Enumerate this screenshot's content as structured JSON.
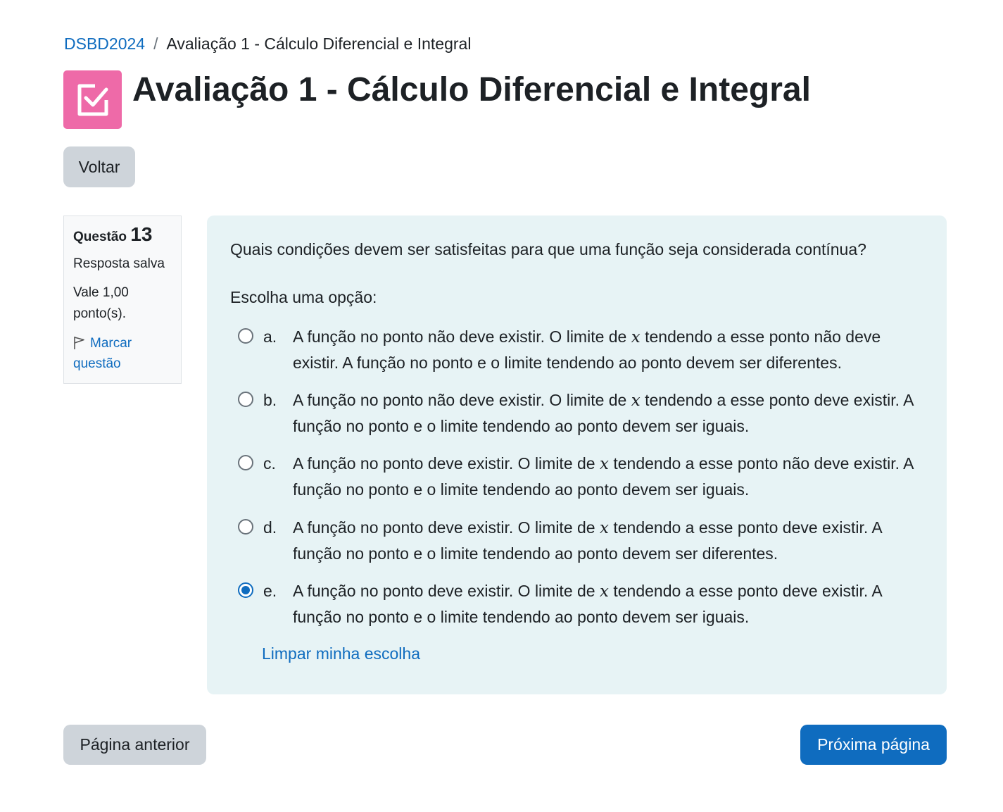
{
  "breadcrumb": {
    "course": "DSBD2024",
    "separator": "/",
    "current": "Avaliação 1 - Cálculo Diferencial e Integral"
  },
  "page": {
    "title": "Avaliação 1 - Cálculo Diferencial e Integral",
    "icon": "quiz-checkbox-icon",
    "icon_color": "#ee6aa8"
  },
  "buttons": {
    "back": "Voltar",
    "prev": "Página anterior",
    "next": "Próxima página"
  },
  "question_info": {
    "label": "Questão",
    "number": "13",
    "state": "Resposta salva",
    "grade": "Vale 1,00 ponto(s).",
    "flag": "Marcar questão"
  },
  "question": {
    "text": "Quais condições devem ser satisfeitas para que uma função seja considerada contínua?",
    "prompt": "Escolha uma opção:",
    "options": [
      {
        "letter": "a.",
        "before": "A função no ponto não deve existir. O limite de ",
        "var": "x",
        "after": " tendendo a esse ponto não deve existir. A função no ponto e o limite tendendo ao ponto devem ser diferentes.",
        "selected": false
      },
      {
        "letter": "b.",
        "before": "A função no ponto não deve existir. O limite de ",
        "var": "x",
        "after": " tendendo a esse ponto deve existir. A função no ponto e o limite tendendo ao ponto devem ser iguais.",
        "selected": false
      },
      {
        "letter": "c.",
        "before": "A função no ponto deve existir. O limite de ",
        "var": "x",
        "after": " tendendo a esse ponto não deve existir. A função no ponto e o limite tendendo ao ponto devem ser iguais.",
        "selected": false
      },
      {
        "letter": "d.",
        "before": "A função no ponto deve existir. O limite de ",
        "var": "x",
        "after": " tendendo a esse ponto deve existir. A função no ponto e o limite tendendo ao ponto devem ser diferentes.",
        "selected": false
      },
      {
        "letter": "e.",
        "before": "A função no ponto deve existir. O limite de ",
        "var": "x",
        "after": " tendendo a esse ponto deve existir. A função no ponto e o limite tendendo ao ponto devem ser iguais.",
        "selected": true
      }
    ],
    "clear_choice": "Limpar minha escolha"
  },
  "colors": {
    "link": "#0f6cbf",
    "primary": "#0f6cbf",
    "secondary": "#ced4da",
    "content_bg": "#e7f3f5"
  }
}
